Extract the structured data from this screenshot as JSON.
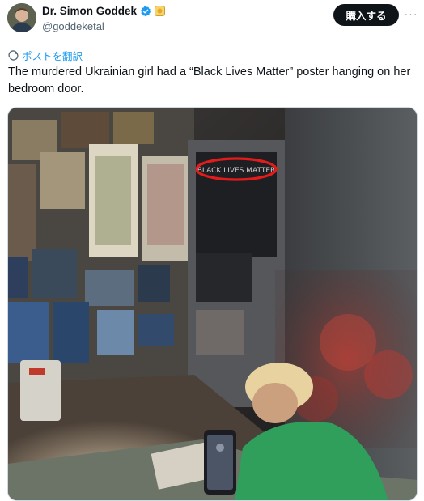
{
  "author": {
    "display_name": "Dr. Simon Goddek",
    "handle": "@goddeketal",
    "verified_icon": "verified-badge-icon",
    "affiliation_icon": "gold-affiliate-badge-icon"
  },
  "actions": {
    "subscribe_label": "購入する",
    "more_label": "···"
  },
  "post": {
    "translate_label": "ポストを翻訳",
    "text": "The murdered Ukrainian girl had a “Black Lives Matter” poster hanging on her bedroom door."
  },
  "media": {
    "poster_text": "BLACK LIVES MATTER",
    "highlight_color": "#e31b1b"
  },
  "colors": {
    "accent": "#1d9bf0",
    "button_bg": "#0f1419",
    "secondary_text": "#536471"
  }
}
